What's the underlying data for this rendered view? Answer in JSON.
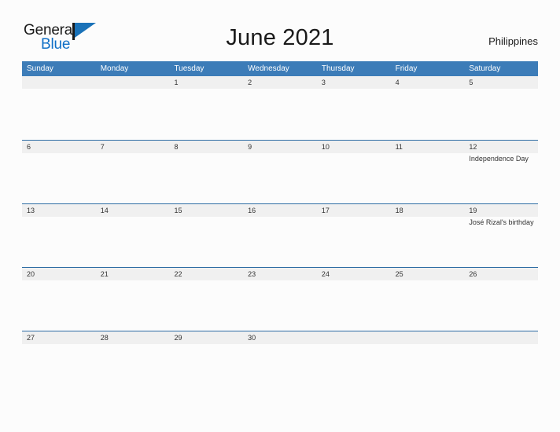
{
  "brand": {
    "name_part1": "General",
    "name_part2": "Blue",
    "flag_icon": "flag-triangle-icon",
    "accent_color": "#0f6fc6"
  },
  "header": {
    "title": "June 2021",
    "country": "Philippines"
  },
  "theme": {
    "header_blue": "#3c7cb8",
    "row_line_blue": "#2e6da4",
    "band_gray": "#f0f0f0",
    "text_dark": "#333333",
    "page_bg": "#fcfcfc"
  },
  "calendar": {
    "month": "June",
    "year": "2021",
    "weekdays": [
      "Sunday",
      "Monday",
      "Tuesday",
      "Wednesday",
      "Thursday",
      "Friday",
      "Saturday"
    ],
    "weeks": [
      [
        {
          "day": "",
          "events": []
        },
        {
          "day": "",
          "events": []
        },
        {
          "day": "1",
          "events": []
        },
        {
          "day": "2",
          "events": []
        },
        {
          "day": "3",
          "events": []
        },
        {
          "day": "4",
          "events": []
        },
        {
          "day": "5",
          "events": []
        }
      ],
      [
        {
          "day": "6",
          "events": []
        },
        {
          "day": "7",
          "events": []
        },
        {
          "day": "8",
          "events": []
        },
        {
          "day": "9",
          "events": []
        },
        {
          "day": "10",
          "events": []
        },
        {
          "day": "11",
          "events": []
        },
        {
          "day": "12",
          "events": [
            "Independence Day"
          ]
        }
      ],
      [
        {
          "day": "13",
          "events": []
        },
        {
          "day": "14",
          "events": []
        },
        {
          "day": "15",
          "events": []
        },
        {
          "day": "16",
          "events": []
        },
        {
          "day": "17",
          "events": []
        },
        {
          "day": "18",
          "events": []
        },
        {
          "day": "19",
          "events": [
            "José Rizal's birthday"
          ]
        }
      ],
      [
        {
          "day": "20",
          "events": []
        },
        {
          "day": "21",
          "events": []
        },
        {
          "day": "22",
          "events": []
        },
        {
          "day": "23",
          "events": []
        },
        {
          "day": "24",
          "events": []
        },
        {
          "day": "25",
          "events": []
        },
        {
          "day": "26",
          "events": []
        }
      ],
      [
        {
          "day": "27",
          "events": []
        },
        {
          "day": "28",
          "events": []
        },
        {
          "day": "29",
          "events": []
        },
        {
          "day": "30",
          "events": []
        },
        {
          "day": "",
          "events": []
        },
        {
          "day": "",
          "events": []
        },
        {
          "day": "",
          "events": []
        }
      ]
    ]
  }
}
